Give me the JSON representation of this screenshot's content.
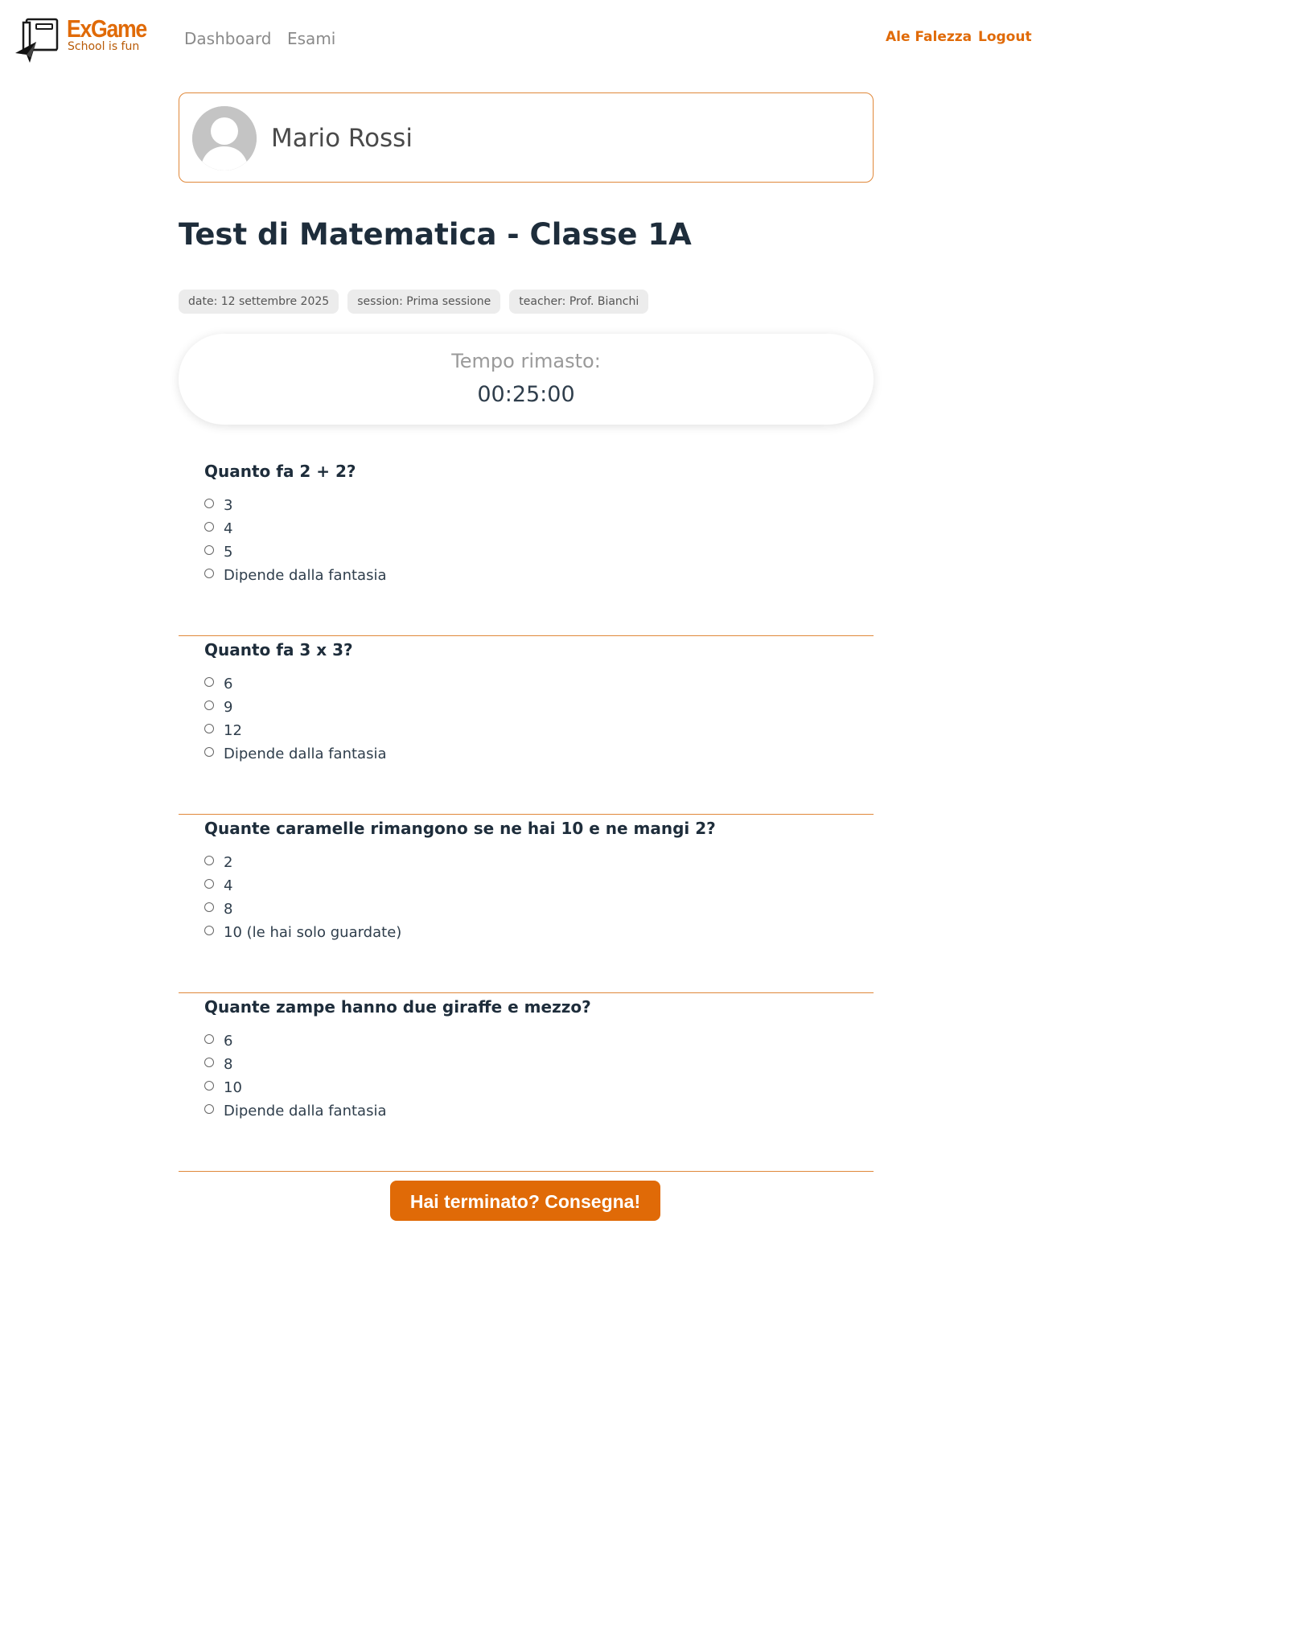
{
  "navbar": {
    "logo_title": "ExGame",
    "logo_subtitle": "School is fun",
    "links": [
      "Dashboard",
      "Esami"
    ],
    "user_name": "Ale Falezza",
    "logout_label": "Logout"
  },
  "profile": {
    "name": "Mario Rossi",
    "avatar_icon": "user-placeholder-icon"
  },
  "exam": {
    "title": "Test di Matematica - Classe 1A",
    "tags": {
      "date": "date: 12 settembre 2025",
      "session": "session: Prima sessione",
      "teacher": "teacher: Prof. Bianchi"
    }
  },
  "timer": {
    "label": "Tempo rimasto:",
    "value": "00:25:00"
  },
  "questions": [
    {
      "text": "Quanto fa 2 + 2?",
      "options": [
        "3",
        "4",
        "5",
        "Dipende dalla fantasia"
      ]
    },
    {
      "text": "Quanto fa 3 x 3?",
      "options": [
        "6",
        "9",
        "12",
        "Dipende dalla fantasia"
      ]
    },
    {
      "text": "Quante caramelle rimangono se ne hai 10 e ne mangi 2?",
      "options": [
        "2",
        "4",
        "8",
        "10 (le hai solo guardate)"
      ]
    },
    {
      "text": "Quante zampe hanno due giraffe e mezzo?",
      "options": [
        "6",
        "8",
        "10",
        "Dipende dalla fantasia"
      ]
    }
  ],
  "submit_label": "Hai terminato? Consegna!",
  "colors": {
    "accent": "#e06a07",
    "border": "#e0883a",
    "text": "#1e2d3b",
    "tag_bg": "#ececec"
  }
}
